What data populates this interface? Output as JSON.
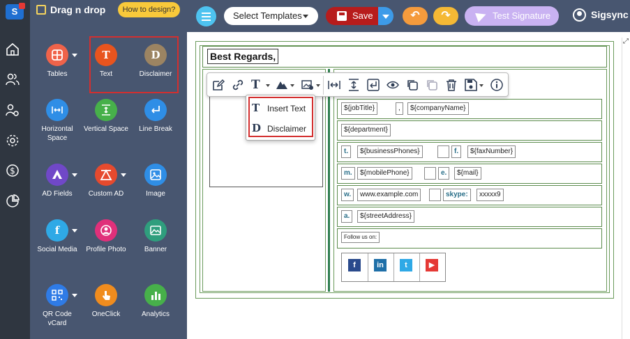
{
  "panel": {
    "title": "Drag n drop",
    "how_label": "How to design?",
    "tools": [
      {
        "label": "Tables",
        "icon": "table-icon",
        "color": "#f0634a",
        "caret": true
      },
      {
        "label": "Text",
        "icon": "text-icon",
        "color": "#e8541e",
        "glyph": "T"
      },
      {
        "label": "Disclaimer",
        "icon": "disclaimer-icon",
        "color": "#9c8462",
        "glyph": "D"
      },
      {
        "label": "Horizontal Space",
        "icon": "horizontal-space-icon",
        "color": "#2f8ee6"
      },
      {
        "label": "Vertical Space",
        "icon": "vertical-space-icon",
        "color": "#47b04a"
      },
      {
        "label": "Line Break",
        "icon": "line-break-icon",
        "color": "#2f8ee6"
      },
      {
        "label": "AD Fields",
        "icon": "ad-fields-icon",
        "color": "#7048c8",
        "caret": true
      },
      {
        "label": "Custom AD",
        "icon": "custom-ad-icon",
        "color": "#e64a2e",
        "caret": true
      },
      {
        "label": "Image",
        "icon": "image-icon",
        "color": "#2f8ee6"
      },
      {
        "label": "Social Media",
        "icon": "social-media-icon",
        "color": "#2fa9e6",
        "glyph": "f",
        "caret": true
      },
      {
        "label": "Profile Photo",
        "icon": "profile-photo-icon",
        "color": "#e0307a"
      },
      {
        "label": "Banner",
        "icon": "banner-icon",
        "color": "#2f9e7d"
      },
      {
        "label": "QR Code vCard",
        "icon": "qr-code-icon",
        "color": "#2f7be6",
        "caret": true
      },
      {
        "label": "OneClick",
        "icon": "oneclick-icon",
        "color": "#f08c1e"
      },
      {
        "label": "Analytics",
        "icon": "analytics-icon",
        "color": "#47b04a"
      }
    ]
  },
  "topbar": {
    "template_select": "Select Templates",
    "save_label": "Save",
    "test_label": "Test Signature",
    "user_name": "Sigsync"
  },
  "signature": {
    "greeting": "Best Regards,",
    "rows": [
      [
        {
          "t": "${jobTitle}"
        },
        {
          "t": ","
        },
        {
          "t": "${companyName}"
        }
      ],
      [
        {
          "t": "${department}"
        }
      ],
      [
        {
          "t": "t.",
          "lbl": true
        },
        {
          "t": "${businessPhones}"
        },
        {
          "t": ""
        },
        {
          "t": "f.",
          "lbl": true
        },
        {
          "t": "${faxNumber}"
        }
      ],
      [
        {
          "t": "m.",
          "lbl": true
        },
        {
          "t": "${mobilePhone}"
        },
        {
          "t": ""
        },
        {
          "t": "e.",
          "lbl": true
        },
        {
          "t": "${mail}"
        }
      ],
      [
        {
          "t": "w.",
          "lbl": true
        },
        {
          "t": "www.example.com"
        },
        {
          "t": ""
        },
        {
          "t": "skype:",
          "lbl": true
        },
        {
          "t": "xxxxx9"
        }
      ],
      [
        {
          "t": "a.",
          "lbl": true
        },
        {
          "t": "${streetAddress}"
        }
      ],
      [
        {
          "t": "Follow us on:"
        }
      ]
    ],
    "social": [
      {
        "icon": "facebook-icon",
        "glyph": "f",
        "color": "#2a4a8c"
      },
      {
        "icon": "linkedin-icon",
        "glyph": "in",
        "color": "#1e6fa8"
      },
      {
        "icon": "twitter-icon",
        "glyph": "t",
        "color": "#2fa9e6"
      },
      {
        "icon": "youtube-icon",
        "glyph": "▶",
        "color": "#e53935"
      }
    ]
  },
  "dropdown": {
    "items": [
      {
        "glyph": "T",
        "label": "Insert Text"
      },
      {
        "glyph": "D",
        "label": "Disclaimer"
      }
    ]
  }
}
